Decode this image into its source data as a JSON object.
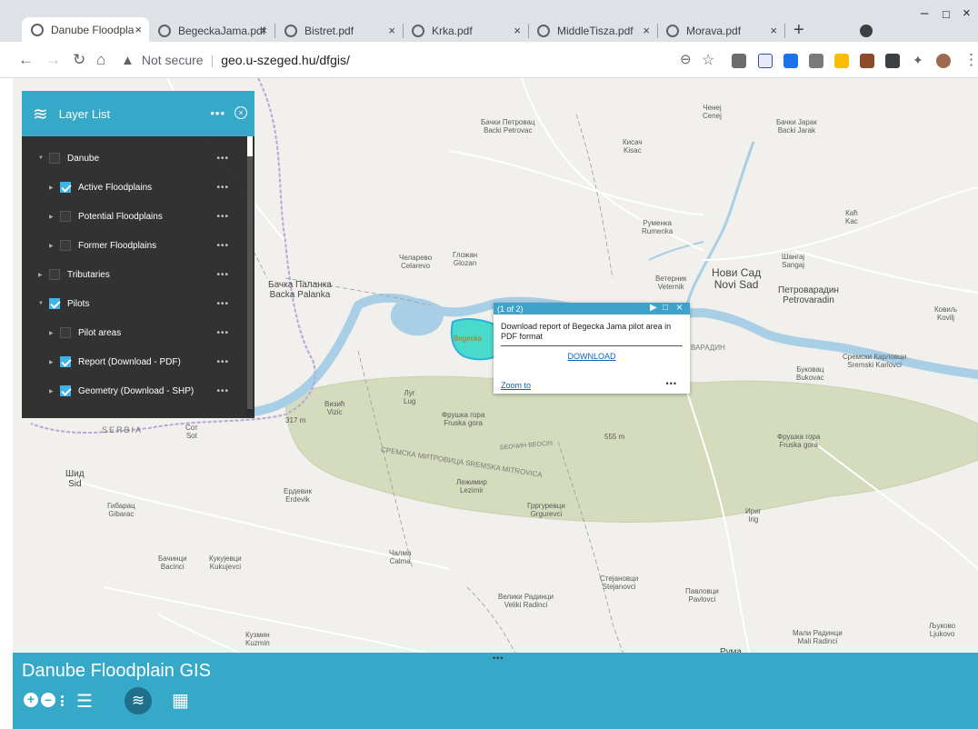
{
  "browser": {
    "tabs": [
      {
        "label": "Danube Floodpla",
        "active": true
      },
      {
        "label": "BegeckaJama.pdf",
        "active": false
      },
      {
        "label": "Bistret.pdf",
        "active": false
      },
      {
        "label": "Krka.pdf",
        "active": false
      },
      {
        "label": "MiddleTisza.pdf",
        "active": false
      },
      {
        "label": "Morava.pdf",
        "active": false
      }
    ],
    "close_glyph": "×",
    "newtab_glyph": "+",
    "minimize_glyph": "–",
    "maximize_glyph": "□",
    "window_close_glyph": "×",
    "security_label": "Not secure",
    "url": "geo.u-szeged.hu/dfgis/"
  },
  "layer_list": {
    "title": "Layer List",
    "items": [
      {
        "label": "Danube",
        "checked": false
      },
      {
        "label": "Active Floodplains",
        "checked": true
      },
      {
        "label": "Potential Floodplains",
        "checked": false
      },
      {
        "label": "Former Floodplains",
        "checked": false
      },
      {
        "label": "Tributaries",
        "checked": false
      },
      {
        "label": "Pilots",
        "checked": true
      },
      {
        "label": "Pilot areas",
        "checked": false
      },
      {
        "label": "Report (Download - PDF)",
        "checked": true
      },
      {
        "label": "Geometry (Download - SHP)",
        "checked": true
      }
    ]
  },
  "popup": {
    "counter": "(1 of 2)",
    "text": "Download report of Begecka Jama pilot area in PDF format",
    "download_label": "DOWNLOAD",
    "zoom_label": "Zoom to",
    "more": "•••"
  },
  "map_labels": {
    "backi_petrovac": "Бачки Петровац\nBacki Petrovac",
    "kisac": "Кисач\nKisac",
    "cenej": "Ченеј\nCenej",
    "backi_jarak": "Бачки Јарак\nBacki Jarak",
    "rumenka": "Руменка\nRumenka",
    "kac": "Каћ\nKac",
    "sangaj": "Шангај\nSangaj",
    "celarevo": "Челарево\nCelarevo",
    "glozan": "Гложан\nGlozan",
    "veternik": "Ветерник\nVeternik",
    "novi_sad": "Нови Сад\nNovi Sad",
    "petrovaradin": "Петроварадин\nPetrovaradin",
    "kovilj": "Ковиљ\nKovilj",
    "backa_palanka": "Бачка Паланка\nBacka Palanka",
    "begecka": "Begecka",
    "sremski_karlovci": "Сремски Карловци\nSremski Karlovci",
    "bukovac": "Буковац\nBukovac",
    "lug": "Луг\nLug",
    "vizic": "Визић\nVizic",
    "fruska_gora": "Фрушка гора\nFruska gora",
    "fruska_gora2": "Фрушка гора\nFruska gora",
    "elev_555": "555 m",
    "elev_317": "317 m",
    "serbia": "SERBIA",
    "sot": "Сот\nSot",
    "sid": "Шид\nSid",
    "erdevik": "Ердевик\nErdevik",
    "lezimir": "Лежимир\nLezimir",
    "grgurevci": "Грргуревци\nGrgurevci",
    "irig": "Ириг\nIrig",
    "gibarac": "Гибарац\nGibarac",
    "bacinci": "Бачинци\nBacinci",
    "kukujevci": "Кукујевци\nKukujevci",
    "calma": "Чалма\nCalma",
    "stejanovci": "Стејановци\nStejanovci",
    "pavlovci": "Павловци\nPavlovci",
    "veliki_radinci": "Велики Радинци\nVeliki Radinci",
    "mali_radinci": "Мали Радинци\nMali Radinci",
    "kuzmin": "Кузмин\nKuzmin",
    "ljukovo": "Љуково\nLjukovo",
    "ruma": "Рума",
    "sremska_mitrovica_rd": "СРЕМСКА МИТРОВИЦА SREMSKA MITROVICA",
    "beocin": "БЕОЧИН BEOCIN",
    "varadin": "ВАРАДИН"
  },
  "bottom_bar": {
    "title": "Danube Floodplain GIS",
    "handle": "•••"
  },
  "colors": {
    "accent": "#37a9c8",
    "popup_header": "#3fa2c8",
    "checkbox_on": "#3fb4e6",
    "river": "#a9cfe6",
    "forest": "#d4dcbd",
    "highlight": "#20d4c4"
  }
}
